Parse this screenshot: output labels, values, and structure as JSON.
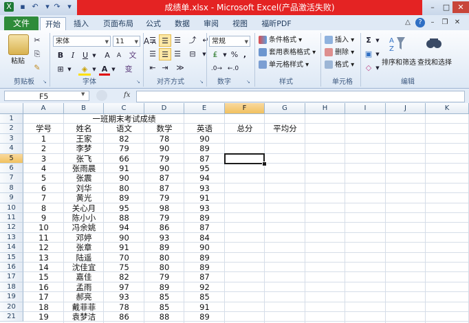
{
  "window": {
    "title": "成绩单.xlsx - Microsoft Excel(产品激活失败)"
  },
  "tabs": [
    "文件",
    "开始",
    "插入",
    "页面布局",
    "公式",
    "数据",
    "审阅",
    "视图",
    "福昕PDF"
  ],
  "ribbon": {
    "clipboard": {
      "paste": "粘贴",
      "label": "剪贴板"
    },
    "font": {
      "name": "宋体",
      "size": "11",
      "bold": "B",
      "italic": "I",
      "underline": "U",
      "grow": "A",
      "shrink": "A",
      "label": "字体"
    },
    "alignment": {
      "label": "对齐方式"
    },
    "number": {
      "format": "常规",
      "percent": "%",
      "comma": ",",
      "label": "数字"
    },
    "styles": {
      "conditional": "条件格式",
      "table": "套用表格格式",
      "cell": "单元格样式",
      "label": "样式"
    },
    "cells": {
      "insert": "插入",
      "delete": "删除",
      "format": "格式",
      "label": "单元格"
    },
    "editing": {
      "sort": "排序和筛选",
      "find": "查找和选择",
      "sigma": "Σ",
      "label": "编辑"
    }
  },
  "formula_bar": {
    "name_box": "F5",
    "fx": "fx",
    "value": ""
  },
  "sheet": {
    "columns": [
      "A",
      "B",
      "C",
      "D",
      "E",
      "F",
      "G",
      "H",
      "I",
      "J",
      "K"
    ],
    "selected_column": "F",
    "selected_row": "5",
    "title": "一班期末考试成绩",
    "headers": [
      "学号",
      "姓名",
      "语文",
      "数学",
      "英语",
      "总分",
      "平均分"
    ],
    "rows": [
      {
        "row": "3",
        "id": "1",
        "name": "王家",
        "chinese": "82",
        "math": "78",
        "english": "90"
      },
      {
        "row": "4",
        "id": "2",
        "name": "李梦",
        "chinese": "79",
        "math": "90",
        "english": "89"
      },
      {
        "row": "5",
        "id": "3",
        "name": "张飞",
        "chinese": "66",
        "math": "79",
        "english": "87"
      },
      {
        "row": "6",
        "id": "4",
        "name": "张雨晨",
        "chinese": "91",
        "math": "90",
        "english": "95"
      },
      {
        "row": "7",
        "id": "5",
        "name": "张震",
        "chinese": "90",
        "math": "87",
        "english": "94"
      },
      {
        "row": "8",
        "id": "6",
        "name": "刘华",
        "chinese": "80",
        "math": "87",
        "english": "93"
      },
      {
        "row": "9",
        "id": "7",
        "name": "黄光",
        "chinese": "89",
        "math": "79",
        "english": "91"
      },
      {
        "row": "10",
        "id": "8",
        "name": "关心月",
        "chinese": "95",
        "math": "98",
        "english": "93"
      },
      {
        "row": "11",
        "id": "9",
        "name": "陈小小",
        "chinese": "88",
        "math": "79",
        "english": "89"
      },
      {
        "row": "12",
        "id": "10",
        "name": "冯余姚",
        "chinese": "94",
        "math": "86",
        "english": "87"
      },
      {
        "row": "13",
        "id": "11",
        "name": "邓婷",
        "chinese": "90",
        "math": "93",
        "english": "84"
      },
      {
        "row": "14",
        "id": "12",
        "name": "张章",
        "chinese": "91",
        "math": "89",
        "english": "90"
      },
      {
        "row": "15",
        "id": "13",
        "name": "陆遥",
        "chinese": "70",
        "math": "80",
        "english": "89"
      },
      {
        "row": "16",
        "id": "14",
        "name": "沈佳宜",
        "chinese": "75",
        "math": "80",
        "english": "89"
      },
      {
        "row": "17",
        "id": "15",
        "name": "嘉佳",
        "chinese": "82",
        "math": "79",
        "english": "87"
      },
      {
        "row": "18",
        "id": "16",
        "name": "孟雨",
        "chinese": "97",
        "math": "89",
        "english": "92"
      },
      {
        "row": "19",
        "id": "17",
        "name": "郝亮",
        "chinese": "93",
        "math": "85",
        "english": "85"
      },
      {
        "row": "20",
        "id": "18",
        "name": "戴菲菲",
        "chinese": "78",
        "math": "85",
        "english": "91"
      },
      {
        "row": "21",
        "id": "19",
        "name": "袁梦洁",
        "chinese": "86",
        "math": "88",
        "english": "89"
      }
    ]
  },
  "colors": {
    "title_bar": "#e42323",
    "file_tab": "#2e8b3a",
    "selection": "#f1c15f"
  }
}
